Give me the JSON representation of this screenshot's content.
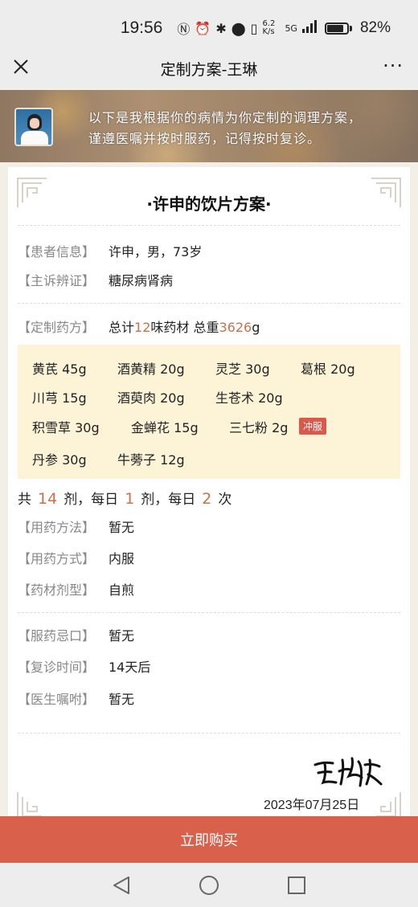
{
  "status_bar": {
    "time": "19:56",
    "network_speed": "6.2 K/s",
    "network_type": "5G",
    "battery_percent": "82%",
    "battery_level": 0.82
  },
  "nav": {
    "title": "定制方案-王琳",
    "more": "···"
  },
  "banner": {
    "line1": "以下是我根据你的病情为你定制的调理方案，",
    "line2": "谨遵医嘱并按时服药，记得按时复诊。"
  },
  "card": {
    "title": "·许申的饮片方案·",
    "patient_label": "【患者信息】",
    "patient_value": "许申，男，73岁",
    "diagnosis_label": "【主诉辨证】",
    "diagnosis_value": "糖尿病肾病",
    "formula_label": "【定制药方】",
    "formula_prefix": "总计",
    "formula_count": "12",
    "formula_mid": "味药材 总重",
    "formula_weight": "3626",
    "formula_unit": "g",
    "herbs": [
      {
        "name": "黄芪 45g"
      },
      {
        "name": "酒黄精 20g"
      },
      {
        "name": "灵芝 30g"
      },
      {
        "name": "葛根 20g"
      },
      {
        "name": "川芎 15g"
      },
      {
        "name": "酒萸肉 20g"
      },
      {
        "name": "生苍术 20g"
      },
      {
        "name": "积雪草 30g"
      },
      {
        "name": "金蝉花 15g"
      },
      {
        "name": "三七粉 2g",
        "tag": "冲服"
      },
      {
        "name": "丹参 30g"
      },
      {
        "name": "牛蒡子 12g"
      }
    ],
    "dose": {
      "t1": "共",
      "doses": "14",
      "t2": "剂，每日",
      "per_day": "1",
      "t3": "剂，每日",
      "times": "2",
      "t4": "次"
    },
    "method_label": "【用药方法】",
    "method_value": "暂无",
    "mode_label": "【用药方式】",
    "mode_value": "内服",
    "form_label": "【药材剂型】",
    "form_value": "自煎",
    "taboo_label": "【服药忌口】",
    "taboo_value": "暂无",
    "revisit_label": "【复诊时间】",
    "revisit_value": "14天后",
    "advice_label": "【医生嘱咐】",
    "advice_value": "暂无",
    "sign_date": "2023年07月25日"
  },
  "buy_button": "立即购买",
  "colors": {
    "accent": "#c8714b",
    "buy": "#d9604b",
    "herb_bg": "#fdf4d8",
    "tag": "#d9594b"
  }
}
